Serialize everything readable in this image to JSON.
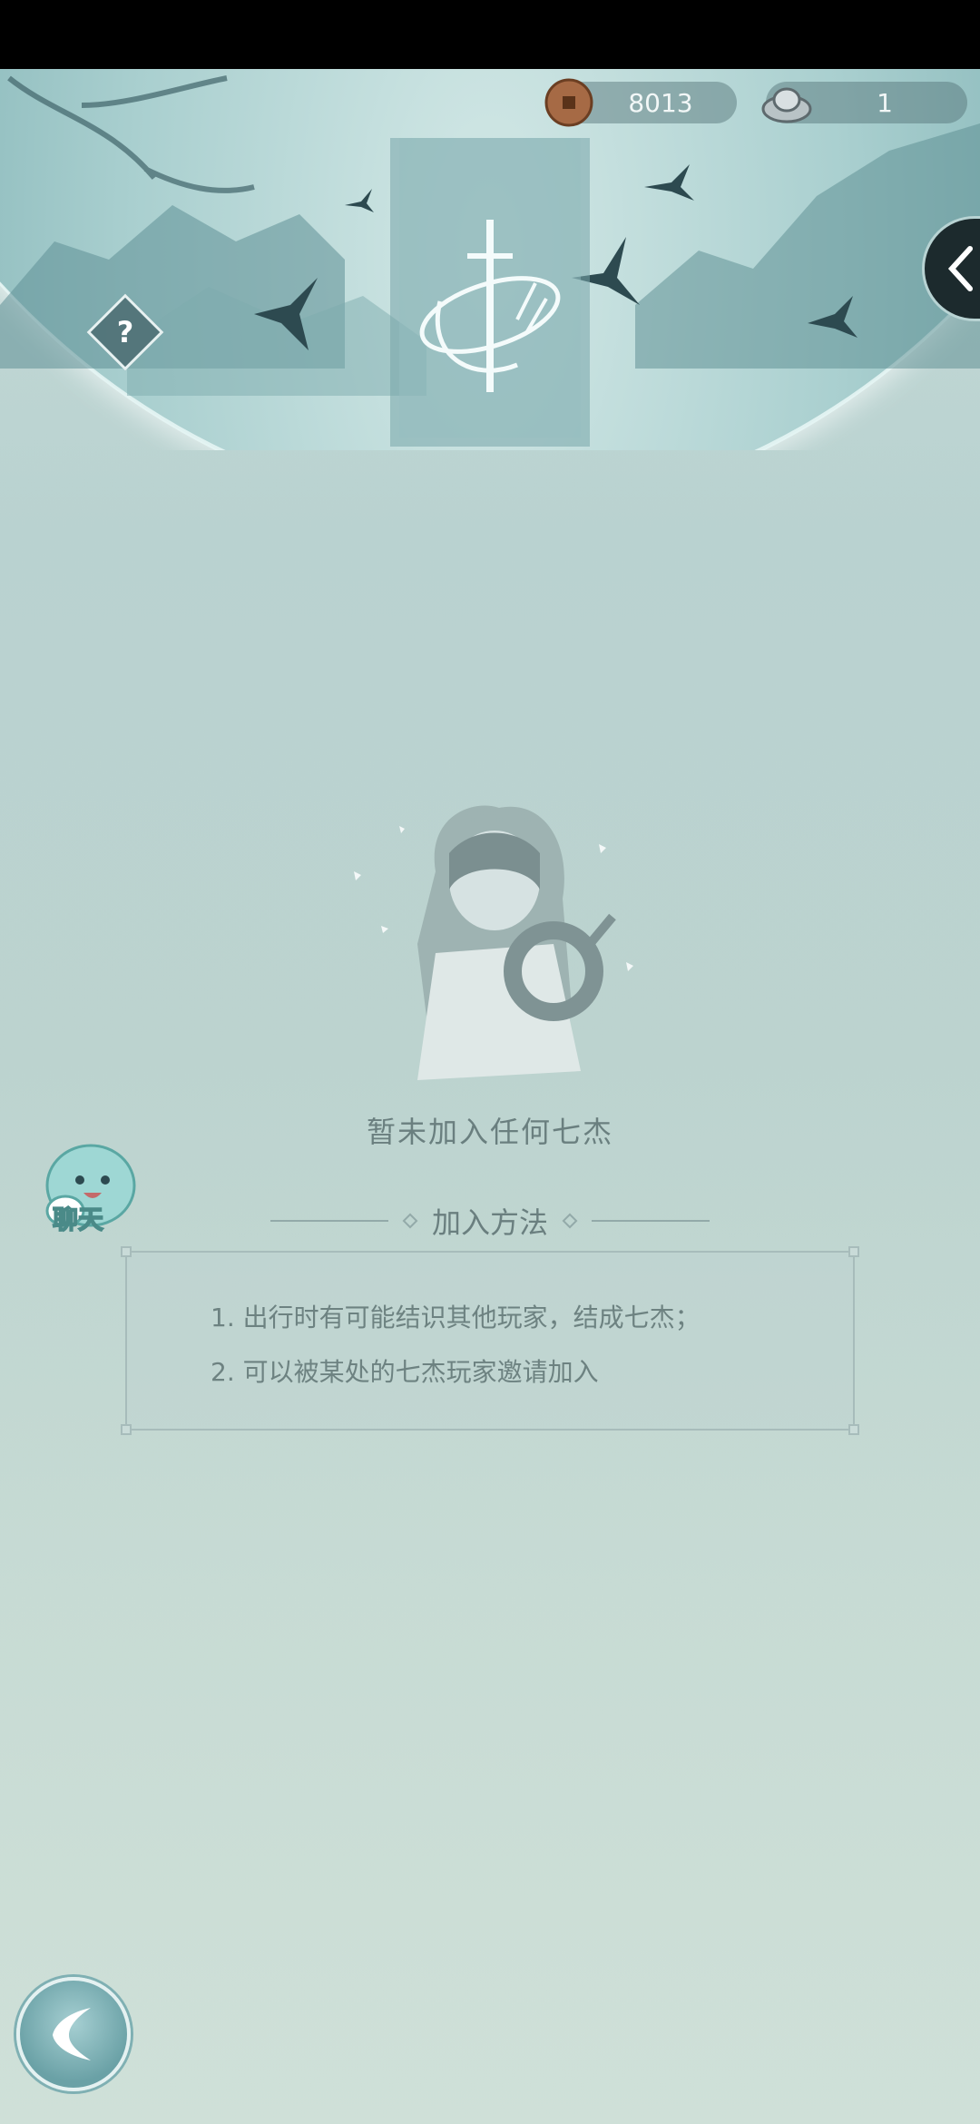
{
  "status_bar": {},
  "header": {
    "coins": {
      "value": "8013",
      "icon": "copper-coin-icon"
    },
    "silver": {
      "value": "1",
      "icon": "silver-ingot-icon"
    }
  },
  "empty_state": {
    "message": "暂未加入任何七杰"
  },
  "chat": {
    "label": "聊天"
  },
  "join_method": {
    "heading": "加入方法",
    "items": [
      "1. 出行时有可能结识其他玩家，结成七杰；",
      "2. 可以被某处的七杰玩家邀请加入"
    ]
  },
  "help": {
    "label": "?"
  }
}
